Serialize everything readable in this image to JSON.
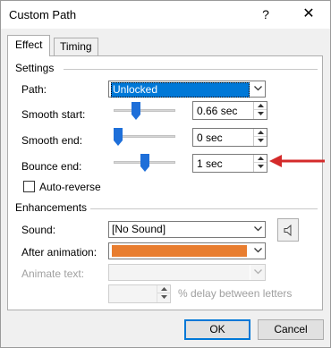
{
  "window": {
    "title": "Custom Path",
    "help_label": "?",
    "close_label": "✕"
  },
  "tabs": [
    {
      "label": "Effect"
    },
    {
      "label": "Timing"
    }
  ],
  "settings": {
    "group_label": "Settings",
    "path": {
      "label": "Path:",
      "value": "Unlocked"
    },
    "smooth_start": {
      "label": "Smooth start:",
      "value": "0.66 sec",
      "level": 0.66
    },
    "smooth_end": {
      "label": "Smooth end:",
      "value": "0 sec",
      "level": 0.0
    },
    "bounce_end": {
      "label": "Bounce end:",
      "value": "1 sec",
      "level": 0.5
    },
    "auto_reverse": {
      "label": "Auto-reverse",
      "checked": false
    }
  },
  "enhancements": {
    "group_label": "Enhancements",
    "sound": {
      "label": "Sound:",
      "value": "[No Sound]",
      "icon": "speaker-icon"
    },
    "after_animation": {
      "label": "After animation:",
      "color": "#e87d2f"
    },
    "animate_text": {
      "label": "Animate text:",
      "value": ""
    },
    "delay": {
      "value": "",
      "suffix": "% delay between letters"
    }
  },
  "buttons": {
    "ok": "OK",
    "cancel": "Cancel"
  },
  "colors": {
    "annotation_arrow": "#d42a2a",
    "selection": "#0078d7",
    "slider_thumb": "#1e6fd9"
  }
}
